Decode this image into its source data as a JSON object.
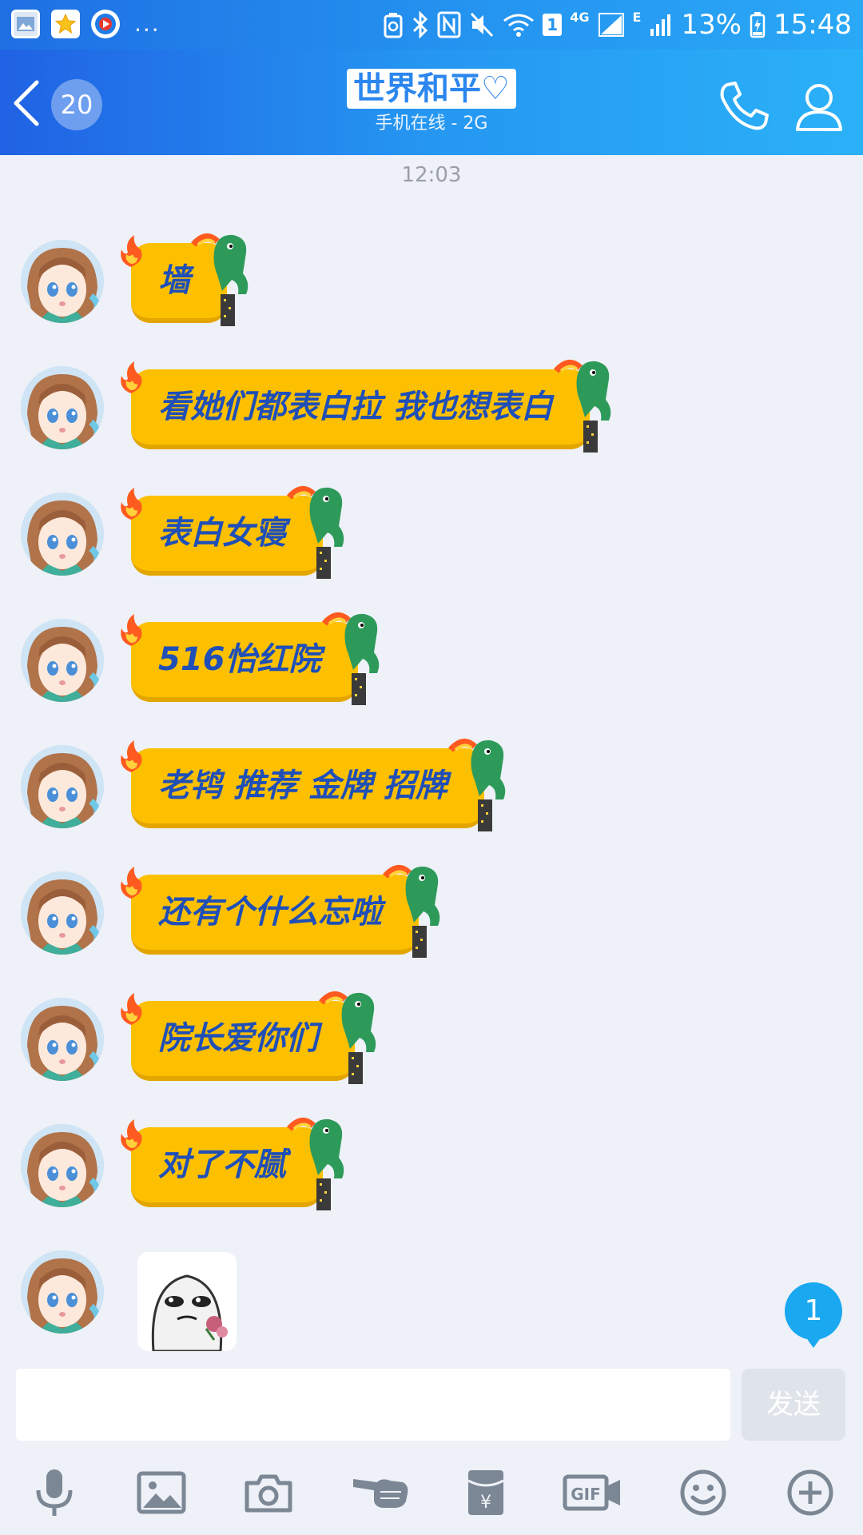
{
  "status_bar": {
    "more_indicator": "...",
    "network_4g": "4G",
    "sim_badge": "1",
    "network_e": "E",
    "battery": "13%",
    "time": "15:48"
  },
  "header": {
    "back_count": "20",
    "title": "世界和平♡",
    "subtitle": "手机在线 - 2G"
  },
  "chat": {
    "timestamp": "12:03",
    "messages": [
      {
        "text": "墙"
      },
      {
        "text": "看她们都表白拉 我也想表白"
      },
      {
        "text": "表白女寝"
      },
      {
        "text": "516怡红院"
      },
      {
        "text": "老鸨 推荐 金牌 招牌"
      },
      {
        "text": "还有个什么忘啦"
      },
      {
        "text": "院长爱你们"
      },
      {
        "text": "对了不腻"
      }
    ],
    "unread_count": "1"
  },
  "input": {
    "placeholder": "",
    "send_label": "发送"
  },
  "colors": {
    "header_start": "#2062e4",
    "header_end": "#2bb1f8",
    "bubble": "#fcc000",
    "bubble_text": "#1f4fb7",
    "background": "#eef1f7",
    "unread_badge": "#1aa8f0"
  },
  "toolbar": [
    "microphone-icon",
    "image-icon",
    "camera-icon",
    "poke-icon",
    "red-packet-icon",
    "gif-icon",
    "emoji-icon",
    "plus-icon"
  ]
}
